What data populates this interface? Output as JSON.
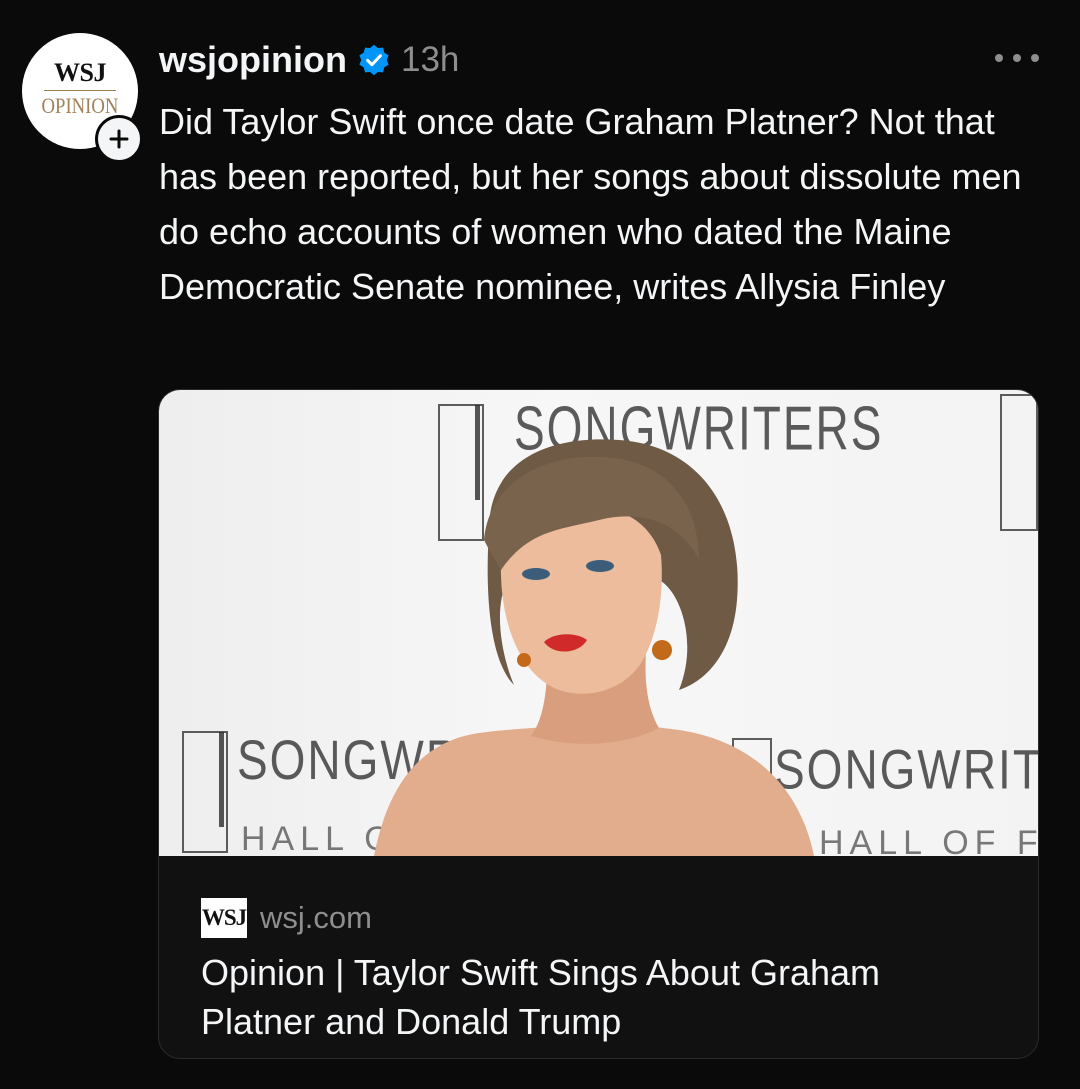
{
  "post": {
    "avatar": {
      "wsj": "WSJ",
      "opinion": "OPINION"
    },
    "username": "wsjopinion",
    "timestamp": "13h",
    "text": "Did Taylor Swift once date Graham Platner? Not that has been reported, but her songs about dissolute men do echo accounts of women who dated the Maine Democratic Senate nominee, writes Allysia Finley"
  },
  "card": {
    "backdrop_text": [
      "SONGWRITERS",
      "HALL OF FAME"
    ],
    "source_logo": "WSJ",
    "domain": "wsj.com",
    "title": "Opinion | Taylor Swift Sings About Graham Platner and Donald Trump"
  },
  "icons": {
    "verified": "verified-badge-icon",
    "follow": "plus-icon",
    "more": "more-dots-icon"
  },
  "colors": {
    "background": "#0a0a0a",
    "text": "#f3f5f7",
    "secondary_text": "#8e8e8e",
    "verified": "#0095f6",
    "opinion_gold": "#a0815a"
  }
}
